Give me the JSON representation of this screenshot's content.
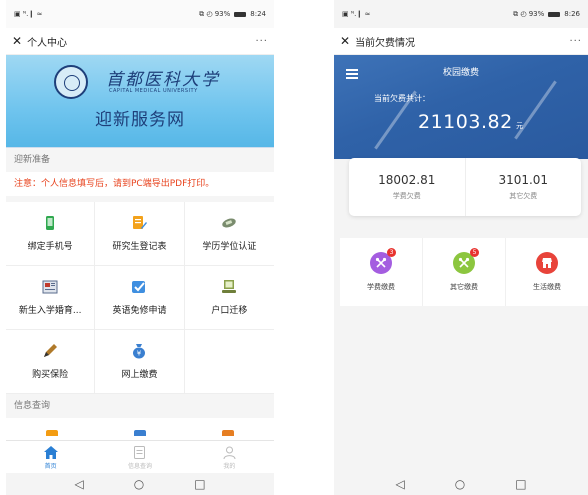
{
  "left": {
    "status": {
      "signal": "▣ ᴺ.❙ ≈",
      "icons": "⧉ ◴ 93%",
      "time": "8:24"
    },
    "topbar": {
      "close": "✕",
      "title": "个人中心",
      "more": "···"
    },
    "banner": {
      "university_name": "首都医科大学",
      "university_en": "CAPITAL MEDICAL UNIVERSITY",
      "welcome": "迎新服务网"
    },
    "section1": "迎新准备",
    "notice": "注意：个人信息填写后，请到PC端导出PDF打印。",
    "grid": [
      {
        "label": "绑定手机号",
        "icon": "phone-icon",
        "color": "#2fa84f"
      },
      {
        "label": "研究生登记表",
        "icon": "form-edit-icon",
        "color": "#f3a21b"
      },
      {
        "label": "学历学位认证",
        "icon": "certificate-icon",
        "color": "#7a8c6e"
      },
      {
        "label": "新生入学婚育...",
        "icon": "newspaper-icon",
        "color": "#5a6b8c"
      },
      {
        "label": "英语免修申请",
        "icon": "checkbox-icon",
        "color": "#3f8fe0"
      },
      {
        "label": "户口迁移",
        "icon": "computer-icon",
        "color": "#8aa04a"
      },
      {
        "label": "购买保险",
        "icon": "pen-icon",
        "color": "#b07a2a"
      },
      {
        "label": "网上缴费",
        "icon": "money-bag-icon",
        "color": "#3a7fd0"
      }
    ],
    "section2": "信息查询",
    "tabs": [
      {
        "label": "首页",
        "icon": "home-icon",
        "active": true
      },
      {
        "label": "信息查询",
        "icon": "document-icon",
        "active": false
      },
      {
        "label": "我的",
        "icon": "user-icon",
        "active": false
      }
    ],
    "nav": {
      "back": "◁",
      "home": "○",
      "recents": "□"
    }
  },
  "right": {
    "status": {
      "signal": "▣ ᴺ.❙ ≈",
      "icons": "⧉ ◴ 93%",
      "time": "8:26"
    },
    "topbar": {
      "close": "✕",
      "title": "当前欠费情况",
      "more": "···"
    },
    "header": {
      "title": "校园缴费",
      "owed_label": "当前欠费共计：",
      "owed_amount": "21103.82",
      "unit": "元"
    },
    "summary": [
      {
        "value": "18002.81",
        "caption": "学费欠费"
      },
      {
        "value": "3101.01",
        "caption": "其它欠费"
      }
    ],
    "fees": [
      {
        "label": "学费缴费",
        "icon": "tuition-fee-icon",
        "color": "#a45de0",
        "badge": "3"
      },
      {
        "label": "其它缴费",
        "icon": "other-fee-icon",
        "color": "#8cc63f",
        "badge": "5"
      },
      {
        "label": "生活缴费",
        "icon": "living-fee-icon",
        "color": "#e8433a",
        "badge": ""
      }
    ],
    "nav": {
      "back": "◁",
      "home": "○",
      "recents": "□"
    }
  }
}
